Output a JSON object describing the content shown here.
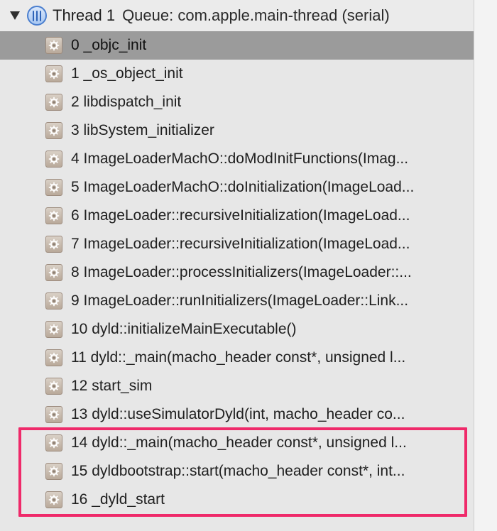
{
  "thread": {
    "title": "Thread 1",
    "queue": "Queue: com.apple.main-thread (serial)"
  },
  "frames": [
    {
      "label": "0 _objc_init"
    },
    {
      "label": "1 _os_object_init"
    },
    {
      "label": "2 libdispatch_init"
    },
    {
      "label": "3 libSystem_initializer"
    },
    {
      "label": "4 ImageLoaderMachO::doModInitFunctions(Imag..."
    },
    {
      "label": "5 ImageLoaderMachO::doInitialization(ImageLoad..."
    },
    {
      "label": "6 ImageLoader::recursiveInitialization(ImageLoad..."
    },
    {
      "label": "7 ImageLoader::recursiveInitialization(ImageLoad..."
    },
    {
      "label": "8 ImageLoader::processInitializers(ImageLoader::..."
    },
    {
      "label": "9 ImageLoader::runInitializers(ImageLoader::Link..."
    },
    {
      "label": "10 dyld::initializeMainExecutable()"
    },
    {
      "label": "11 dyld::_main(macho_header const*, unsigned l..."
    },
    {
      "label": "12 start_sim"
    },
    {
      "label": "13 dyld::useSimulatorDyld(int, macho_header co..."
    },
    {
      "label": "14 dyld::_main(macho_header const*, unsigned l..."
    },
    {
      "label": "15 dyldbootstrap::start(macho_header const*, int..."
    },
    {
      "label": "16 _dyld_start"
    }
  ],
  "colors": {
    "highlight": "#ef2a6a",
    "selected_row": "#9b9b9b"
  },
  "icons": {
    "thread": "thread-icon",
    "frame": "gear-icon",
    "disclosure": "disclosure-triangle-icon"
  }
}
